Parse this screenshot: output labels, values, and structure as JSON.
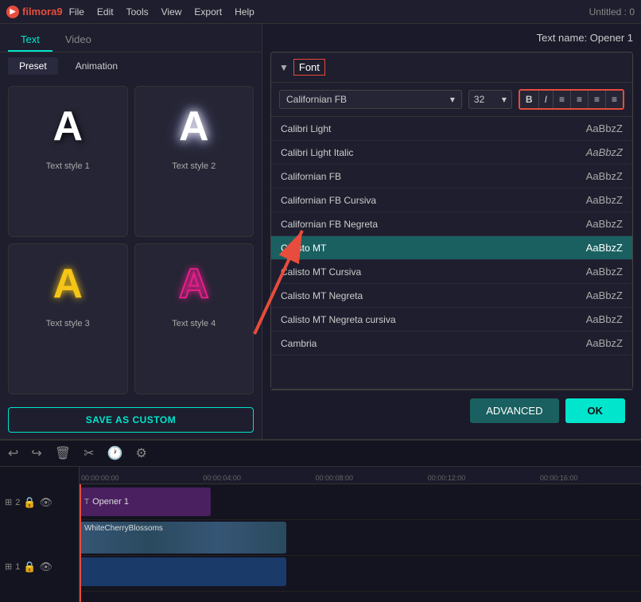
{
  "titlebar": {
    "logo": "filmora9",
    "menus": [
      "File",
      "Edit",
      "Tools",
      "View",
      "Export",
      "Help"
    ],
    "title": "Untitled : 0"
  },
  "tabs": {
    "main": [
      "Text",
      "Video"
    ],
    "active_main": "Text",
    "sub": [
      "Preset",
      "Animation"
    ],
    "active_sub": "Preset"
  },
  "styles": [
    {
      "id": "style1",
      "label": "Text style 1",
      "class": "s1"
    },
    {
      "id": "style2",
      "label": "Text style 2",
      "class": "s2"
    },
    {
      "id": "style3",
      "label": "Text style 3",
      "class": "s3"
    },
    {
      "id": "style4",
      "label": "Text style 4",
      "class": "s4"
    }
  ],
  "save_custom_label": "SAVE AS CUSTOM",
  "font_panel": {
    "text_name": "Text name: Opener 1",
    "section_label": "Font",
    "font_selected": "Californian FB",
    "size_selected": "32",
    "format_buttons": [
      "B",
      "I",
      "≡",
      "≡",
      "≡",
      "≡"
    ],
    "fonts": [
      {
        "name": "Calibri Light",
        "preview": "AaBbzZ",
        "selected": false
      },
      {
        "name": "Calibri Light Italic",
        "preview": "AaBbzZ",
        "italic": true,
        "selected": false
      },
      {
        "name": "Californian FB",
        "preview": "AaBbzZ",
        "selected": false
      },
      {
        "name": "Californian FB Cursiva",
        "preview": "AaBbzZ",
        "selected": false
      },
      {
        "name": "Californian FB Negreta",
        "preview": "AaBbzZ",
        "selected": false
      },
      {
        "name": "Calisto MT",
        "preview": "AaBbzZ",
        "selected": true
      },
      {
        "name": "Calisto MT Cursiva",
        "preview": "AaBbzZ",
        "selected": false
      },
      {
        "name": "Calisto MT Negreta",
        "preview": "AaBbzZ",
        "selected": false
      },
      {
        "name": "Calisto MT Negreta cursiva",
        "preview": "AaBbzZ",
        "selected": false
      },
      {
        "name": "Cambria",
        "preview": "AaBbzZ",
        "selected": false
      }
    ]
  },
  "buttons": {
    "advanced": "ADVANCED",
    "ok": "OK"
  },
  "timeline": {
    "toolbar_icons": [
      "↩",
      "↪",
      "🗑",
      "✂",
      "🕐",
      "⚙"
    ],
    "ruler_marks": [
      "00:00:00:00",
      "00:00:04:00",
      "00:00:08:00",
      "00:00:12:00",
      "00:00:16:00"
    ],
    "tracks": [
      {
        "id": "track2",
        "num": "2",
        "clip": "Opener 1"
      },
      {
        "id": "track1",
        "num": "1",
        "clip": "WhiteCherryBlossoms"
      }
    ]
  }
}
